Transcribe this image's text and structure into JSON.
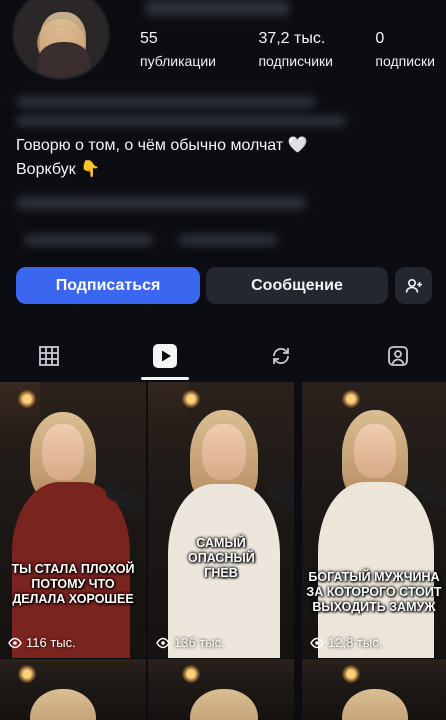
{
  "profile": {
    "stats": [
      {
        "value": "55",
        "label": "публикации"
      },
      {
        "value": "37,2 тыс.",
        "label": "подписчики"
      },
      {
        "value": "0",
        "label": "подписки"
      }
    ],
    "bio_line1": "Говорю о том, о чём обычно молчат 🤍",
    "bio_line2": "Воркбук 👇"
  },
  "actions": {
    "subscribe": "Подписаться",
    "message": "Сообщение"
  },
  "tabs": [
    "grid-icon",
    "reels-icon",
    "reposts-icon",
    "tagged-icon"
  ],
  "posts": [
    {
      "caption": "ТЫ СТАЛА ПЛОХОЙ ПОТОМУ ЧТО ДЕЛАЛА ХОРОШЕЕ",
      "views": "116 тыс."
    },
    {
      "caption": "САМЫЙ ОПАСНЫЙ ГНЕВ",
      "views": "136 тыс."
    },
    {
      "caption": "БОГАТЫЙ МУЖЧИНА ЗА КОТОРОГО СТОИТ ВЫХОДИТЬ ЗАМУЖ",
      "views": "12,8 тыс."
    }
  ],
  "colors": {
    "accent": "#3b66f0",
    "background": "#0b0d12",
    "button_secondary": "#24272e"
  }
}
